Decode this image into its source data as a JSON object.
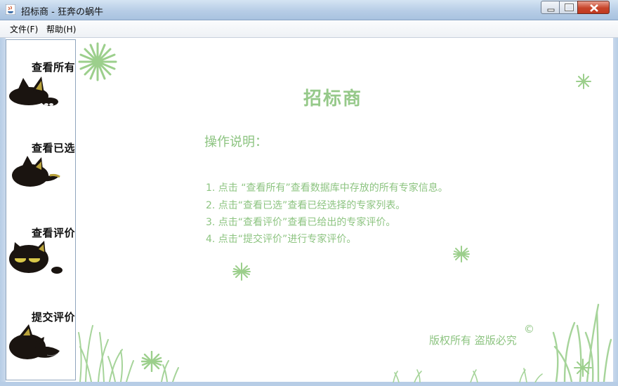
{
  "window": {
    "title": "招标商 - 狂奔の蜗牛"
  },
  "menu": {
    "items": [
      {
        "label": "文件(F)"
      },
      {
        "label": "帮助(H)"
      }
    ]
  },
  "sidebar": {
    "items": [
      {
        "label": "查看所有"
      },
      {
        "label": "查看已选"
      },
      {
        "label": "查看评价"
      },
      {
        "label": "提交评价"
      }
    ]
  },
  "main": {
    "title": "招标商",
    "instructions_heading": "操作说明：",
    "instructions": [
      "1. 点击 “查看所有”查看数据库中存放的所有专家信息。",
      "2. 点击“查看已选”查看已经选择的专家列表。",
      "3. 点击“查看评价”查看已给出的专家评价。",
      "4. 点击“提交评价”进行专家评价。"
    ],
    "copyright": "版权所有 盗版必究",
    "copyright_symbol": "©"
  },
  "colors": {
    "accent_green": "#8dc481",
    "titlebar": "#b7cde6",
    "close_button": "#c7452b"
  },
  "icons": [
    "java-app-icon",
    "minimize-icon",
    "maximize-icon",
    "close-icon",
    "black-cat-icon",
    "star-flower-icon",
    "grass-icon"
  ]
}
